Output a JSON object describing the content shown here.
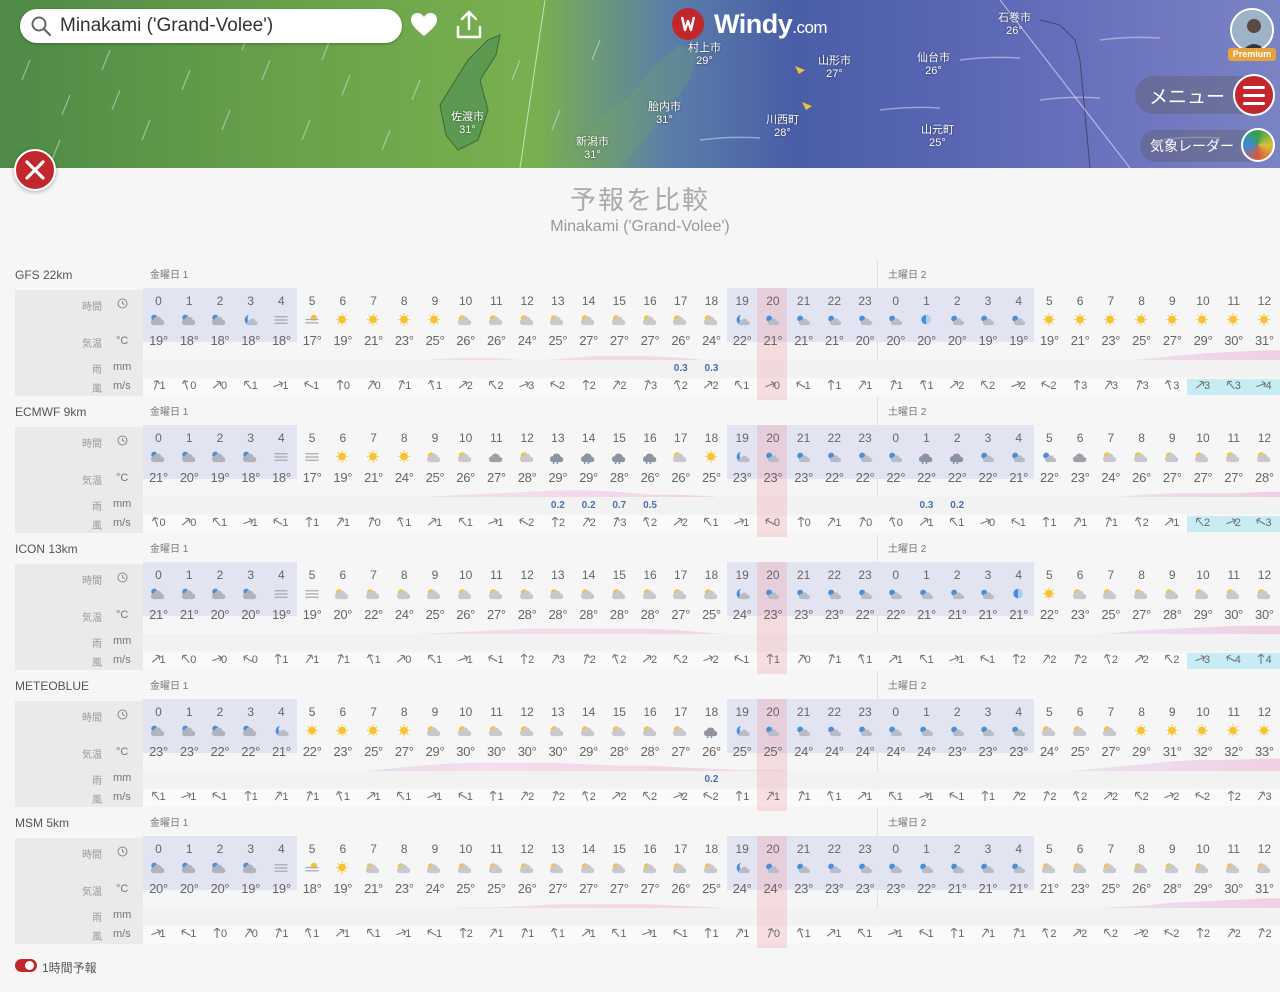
{
  "search": {
    "value": "Minakami ('Grand-Volee')"
  },
  "logo": {
    "name": "Windy",
    "suffix": ".com"
  },
  "premium": "Premium",
  "menu": {
    "label": "メニュー"
  },
  "radar": {
    "label": "気象レーダー"
  },
  "map_cities": [
    {
      "name": "村上市",
      "temp": "29°"
    },
    {
      "name": "山形市",
      "temp": "27°"
    },
    {
      "name": "仙台市",
      "temp": "26°"
    },
    {
      "name": "石巻市",
      "temp": "26°"
    },
    {
      "name": "佐渡市",
      "temp": "31°"
    },
    {
      "name": "胎内市",
      "temp": "31°"
    },
    {
      "name": "川西町",
      "temp": "28°"
    },
    {
      "name": "新潟市",
      "temp": "31°"
    },
    {
      "name": "山元町",
      "temp": "25°"
    }
  ],
  "page": {
    "title": "予報を比較",
    "subtitle": "Minakami ('Grand-Volee')"
  },
  "labels": {
    "time": "時間",
    "temp": "気温",
    "temp_unit": "°C",
    "rain": "雨",
    "rain_unit": "mm",
    "wind": "風",
    "wind_unit": "m/s"
  },
  "days": {
    "d1": "金曜日 1",
    "d2": "土曜日 2"
  },
  "hours": [
    "0",
    "1",
    "2",
    "3",
    "4",
    "5",
    "6",
    "7",
    "8",
    "9",
    "10",
    "11",
    "12",
    "13",
    "14",
    "15",
    "16",
    "17",
    "18",
    "19",
    "20",
    "21",
    "22",
    "23",
    "0",
    "1",
    "2",
    "3",
    "4",
    "5",
    "6",
    "7",
    "8",
    "9",
    "10",
    "11",
    "12"
  ],
  "models": [
    {
      "name": "GFS 22km",
      "temps": [
        "19°",
        "18°",
        "18°",
        "18°",
        "18°",
        "17°",
        "19°",
        "21°",
        "23°",
        "25°",
        "26°",
        "26°",
        "24°",
        "25°",
        "27°",
        "27°",
        "27°",
        "26°",
        "24°",
        "22°",
        "21°",
        "21°",
        "21°",
        "20°",
        "20°",
        "20°",
        "20°",
        "19°",
        "19°",
        "19°",
        "21°",
        "23°",
        "25°",
        "27°",
        "29°",
        "30°",
        "31°"
      ],
      "rain": [
        "",
        "",
        "",
        "",
        "",
        "",
        "",
        "",
        "",
        "",
        "",
        "",
        "",
        "",
        "",
        "",
        "",
        "0.3",
        "0.3",
        "",
        "",
        "",
        "",
        "",
        "",
        "",
        "",
        "",
        "",
        "",
        "",
        "",
        "",
        "",
        "",
        "",
        ""
      ],
      "wind": [
        "1",
        "0",
        "0",
        "1",
        "1",
        "1",
        "0",
        "0",
        "1",
        "1",
        "2",
        "2",
        "3",
        "2",
        "2",
        "2",
        "3",
        "2",
        "2",
        "1",
        "0",
        "1",
        "1",
        "1",
        "1",
        "1",
        "2",
        "2",
        "2",
        "2",
        "3",
        "3",
        "3",
        "3",
        "3",
        "3",
        "4"
      ],
      "wx": [
        "cn",
        "cn",
        "cn",
        "cm",
        "fg",
        "fs",
        "su",
        "su",
        "su",
        "su",
        "sc",
        "sc",
        "sc",
        "sc",
        "sc",
        "sc",
        "sc",
        "sc",
        "sc",
        "cm",
        "mc",
        "mc",
        "mc",
        "mc",
        "mc",
        "mo",
        "mc",
        "mc",
        "mc",
        "su",
        "su",
        "su",
        "su",
        "su",
        "su",
        "su",
        "su"
      ]
    },
    {
      "name": "ECMWF 9km",
      "temps": [
        "21°",
        "20°",
        "19°",
        "18°",
        "18°",
        "17°",
        "19°",
        "21°",
        "24°",
        "25°",
        "26°",
        "27°",
        "28°",
        "29°",
        "29°",
        "28°",
        "26°",
        "26°",
        "25°",
        "23°",
        "23°",
        "23°",
        "22°",
        "22°",
        "22°",
        "22°",
        "22°",
        "22°",
        "21°",
        "22°",
        "23°",
        "24°",
        "26°",
        "27°",
        "27°",
        "27°",
        "28°"
      ],
      "rain": [
        "",
        "",
        "",
        "",
        "",
        "",
        "",
        "",
        "",
        "",
        "",
        "",
        "",
        "0.2",
        "0.2",
        "0.7",
        "0.5",
        "",
        "",
        "",
        "",
        "",
        "",
        "",
        "",
        "0.3",
        "0.2",
        "",
        "",
        "",
        "",
        "",
        "",
        "",
        "",
        "",
        ""
      ],
      "wind": [
        "0",
        "0",
        "1",
        "1",
        "1",
        "1",
        "1",
        "0",
        "1",
        "1",
        "1",
        "1",
        "2",
        "2",
        "2",
        "3",
        "2",
        "2",
        "1",
        "1",
        "0",
        "0",
        "1",
        "0",
        "0",
        "1",
        "1",
        "0",
        "1",
        "1",
        "1",
        "1",
        "2",
        "1",
        "2",
        "2",
        "3"
      ],
      "wx": [
        "cn",
        "cn",
        "cn",
        "cn",
        "fg",
        "fg",
        "su",
        "su",
        "su",
        "sc",
        "sc",
        "cl",
        "sc",
        "rn",
        "rn",
        "rn",
        "rn",
        "sc",
        "su",
        "cm",
        "mc",
        "mc",
        "mc",
        "mc",
        "mc",
        "rn",
        "rn",
        "mc",
        "mc",
        "mc",
        "cl",
        "sc",
        "sc",
        "sc",
        "sc",
        "sc",
        "sc"
      ]
    },
    {
      "name": "ICON 13km",
      "temps": [
        "21°",
        "21°",
        "20°",
        "20°",
        "19°",
        "19°",
        "20°",
        "22°",
        "24°",
        "25°",
        "26°",
        "27°",
        "28°",
        "28°",
        "28°",
        "28°",
        "28°",
        "27°",
        "25°",
        "24°",
        "23°",
        "23°",
        "23°",
        "22°",
        "22°",
        "21°",
        "21°",
        "21°",
        "21°",
        "22°",
        "23°",
        "25°",
        "27°",
        "28°",
        "29°",
        "30°",
        "30°"
      ],
      "rain": [
        "",
        "",
        "",
        "",
        "",
        "",
        "",
        "",
        "",
        "",
        "",
        "",
        "",
        "",
        "",
        "",
        "",
        "",
        "",
        "",
        "",
        "",
        "",
        "",
        "",
        "",
        "",
        "",
        "",
        "",
        "",
        "",
        "",
        "",
        "",
        "",
        ""
      ],
      "wind": [
        "1",
        "0",
        "0",
        "0",
        "1",
        "1",
        "1",
        "1",
        "0",
        "1",
        "1",
        "1",
        "2",
        "3",
        "2",
        "2",
        "2",
        "2",
        "2",
        "1",
        "1",
        "0",
        "1",
        "1",
        "1",
        "1",
        "1",
        "1",
        "2",
        "2",
        "2",
        "2",
        "2",
        "2",
        "3",
        "4",
        "4"
      ],
      "wx": [
        "cn",
        "cn",
        "cn",
        "cn",
        "fg",
        "fg",
        "sc",
        "sc",
        "sc",
        "sc",
        "sc",
        "sc",
        "sc",
        "sc",
        "sc",
        "sc",
        "sc",
        "sc",
        "sc",
        "cm",
        "mc",
        "mc",
        "mc",
        "mc",
        "mc",
        "mc",
        "mc",
        "mc",
        "mo",
        "su",
        "sc",
        "sc",
        "sc",
        "sc",
        "sc",
        "sc",
        "sc"
      ]
    },
    {
      "name": "METEOBLUE",
      "temps": [
        "23°",
        "23°",
        "22°",
        "22°",
        "21°",
        "22°",
        "23°",
        "25°",
        "27°",
        "29°",
        "30°",
        "30°",
        "30°",
        "30°",
        "29°",
        "28°",
        "28°",
        "27°",
        "26°",
        "25°",
        "25°",
        "24°",
        "24°",
        "24°",
        "24°",
        "24°",
        "23°",
        "23°",
        "23°",
        "24°",
        "25°",
        "27°",
        "29°",
        "31°",
        "32°",
        "32°",
        "33°"
      ],
      "rain": [
        "",
        "",
        "",
        "",
        "",
        "",
        "",
        "",
        "",
        "",
        "",
        "",
        "",
        "",
        "",
        "",
        "",
        "",
        "0.2",
        "",
        "",
        "",
        "",
        "",
        "",
        "",
        "",
        "",
        "",
        "",
        "",
        "",
        "",
        "",
        "",
        "",
        ""
      ],
      "wind": [
        "1",
        "1",
        "1",
        "1",
        "1",
        "1",
        "1",
        "1",
        "1",
        "1",
        "1",
        "1",
        "2",
        "2",
        "2",
        "2",
        "2",
        "2",
        "2",
        "1",
        "1",
        "1",
        "1",
        "1",
        "1",
        "1",
        "1",
        "1",
        "2",
        "2",
        "2",
        "2",
        "2",
        "2",
        "2",
        "2",
        "3"
      ],
      "wx": [
        "cn",
        "cn",
        "cn",
        "cn",
        "cm",
        "su",
        "su",
        "su",
        "su",
        "sc",
        "sc",
        "sc",
        "sc",
        "sc",
        "sc",
        "sc",
        "sc",
        "sc",
        "rn",
        "cm",
        "mc",
        "mc",
        "mc",
        "mc",
        "mc",
        "mc",
        "mc",
        "mc",
        "mc",
        "sc",
        "sc",
        "sc",
        "su",
        "su",
        "su",
        "su",
        "su"
      ]
    },
    {
      "name": "MSM 5km",
      "temps": [
        "20°",
        "20°",
        "20°",
        "19°",
        "19°",
        "18°",
        "19°",
        "21°",
        "23°",
        "24°",
        "25°",
        "25°",
        "26°",
        "27°",
        "27°",
        "27°",
        "27°",
        "26°",
        "25°",
        "24°",
        "24°",
        "23°",
        "23°",
        "23°",
        "23°",
        "22°",
        "21°",
        "21°",
        "21°",
        "21°",
        "23°",
        "25°",
        "26°",
        "28°",
        "29°",
        "30°",
        "31°"
      ],
      "rain": [
        "",
        "",
        "",
        "",
        "",
        "",
        "",
        "",
        "",
        "",
        "",
        "",
        "",
        "",
        "",
        "",
        "",
        "",
        "",
        "",
        "",
        "",
        "",
        "",
        "",
        "",
        "",
        "",
        "",
        "",
        "",
        "",
        "",
        "",
        "",
        "",
        ""
      ],
      "wind": [
        "1",
        "1",
        "0",
        "0",
        "1",
        "1",
        "1",
        "1",
        "1",
        "1",
        "2",
        "1",
        "1",
        "1",
        "1",
        "1",
        "1",
        "1",
        "1",
        "1",
        "0",
        "1",
        "1",
        "1",
        "1",
        "1",
        "1",
        "1",
        "1",
        "2",
        "2",
        "2",
        "2",
        "2",
        "2",
        "2",
        "2"
      ],
      "wx": [
        "cn",
        "cn",
        "cn",
        "cn",
        "fg",
        "fs",
        "su",
        "sc",
        "sc",
        "sc",
        "sc",
        "sc",
        "sc",
        "sc",
        "sc",
        "sc",
        "sc",
        "sc",
        "sc",
        "cm",
        "mc",
        "mc",
        "mc",
        "mc",
        "mc",
        "mc",
        "mc",
        "mc",
        "mc",
        "sc",
        "sc",
        "sc",
        "sc",
        "sc",
        "sc",
        "sc",
        "sc"
      ]
    }
  ],
  "toggle": {
    "label": "1時間予報"
  }
}
